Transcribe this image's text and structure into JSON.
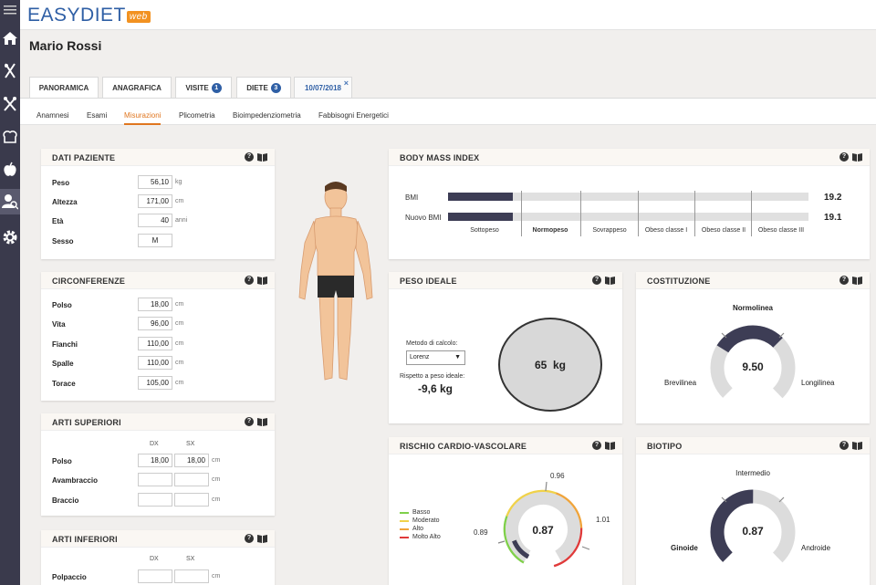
{
  "app": {
    "logo_main": "EASYDIET",
    "logo_web": "web"
  },
  "sidebar": {
    "items": [
      {
        "icon": "menu-icon"
      },
      {
        "icon": "home-icon"
      },
      {
        "icon": "cutlery-icon"
      },
      {
        "icon": "tools-icon"
      },
      {
        "icon": "chef-hat-icon"
      },
      {
        "icon": "apple-icon"
      },
      {
        "icon": "user-search-icon",
        "active": true
      },
      {
        "icon": "gear-icon"
      }
    ]
  },
  "patient": {
    "name": "Mario Rossi"
  },
  "tabs": [
    {
      "label": "PANORAMICA"
    },
    {
      "label": "ANAGRAFICA"
    },
    {
      "label": "VISITE",
      "badge": "1"
    },
    {
      "label": "DIETE",
      "badge": "3"
    },
    {
      "label": "10/07/2018",
      "close": "×"
    }
  ],
  "subnav": [
    "Anamnesi",
    "Esami",
    "Misurazioni",
    "Plicometria",
    "Bioimpedenziometria",
    "Fabbisogni Energetici"
  ],
  "dati_paziente": {
    "title": "DATI PAZIENTE",
    "rows": [
      {
        "label": "Peso",
        "value": "56,10",
        "unit": "kg"
      },
      {
        "label": "Altezza",
        "value": "171,00",
        "unit": "cm"
      },
      {
        "label": "Età",
        "value": "40",
        "unit": "anni"
      },
      {
        "label": "Sesso",
        "value": "M",
        "unit": ""
      }
    ]
  },
  "circonferenze": {
    "title": "CIRCONFERENZE",
    "rows": [
      {
        "label": "Polso",
        "value": "18,00",
        "unit": "cm"
      },
      {
        "label": "Vita",
        "value": "96,00",
        "unit": "cm"
      },
      {
        "label": "Fianchi",
        "value": "110,00",
        "unit": "cm"
      },
      {
        "label": "Spalle",
        "value": "110,00",
        "unit": "cm"
      },
      {
        "label": "Torace",
        "value": "105,00",
        "unit": "cm"
      }
    ]
  },
  "arti_superiori": {
    "title": "ARTI SUPERIORI",
    "col_dx": "DX",
    "col_sx": "SX",
    "rows": [
      {
        "label": "Polso",
        "dx": "18,00",
        "sx": "18,00",
        "unit": "cm"
      },
      {
        "label": "Avambraccio",
        "dx": "",
        "sx": "",
        "unit": "cm"
      },
      {
        "label": "Braccio",
        "dx": "",
        "sx": "",
        "unit": "cm"
      }
    ]
  },
  "arti_inferiori": {
    "title": "ARTI INFERIORI",
    "col_dx": "DX",
    "col_sx": "SX",
    "rows": [
      {
        "label": "Polpaccio",
        "dx": "",
        "sx": "",
        "unit": "cm"
      }
    ]
  },
  "bmi": {
    "title": "BODY MASS INDEX",
    "rows": [
      {
        "label": "BMI",
        "value": "19.2",
        "fill_fraction": 0.18
      },
      {
        "label": "Nuovo BMI",
        "value": "19.1",
        "fill_fraction": 0.18
      }
    ],
    "categories": [
      "Sottopeso",
      "Normopeso",
      "Sovrappeso",
      "Obeso classe I",
      "Obeso classe II",
      "Obeso classe III"
    ],
    "active_category": "Normopeso"
  },
  "peso_ideale": {
    "title": "PESO IDEALE",
    "method_label": "Metodo di calcolo:",
    "method_value": "Lorenz",
    "diff_label": "Rispetto a peso ideale:",
    "diff_value": "-9,6 kg",
    "ideal_value": "65  kg"
  },
  "costituzione": {
    "title": "COSTITUZIONE",
    "value": "9.50",
    "label_top": "Normolinea",
    "label_left": "Brevilinea",
    "label_right": "Longilinea"
  },
  "rischio": {
    "title": "RISCHIO CARDIO-VASCOLARE",
    "value": "0.87",
    "mark_top": "0.96",
    "mark_left": "0.89",
    "mark_right": "1.01",
    "legend": [
      {
        "label": "Basso",
        "color": "#7fd04a"
      },
      {
        "label": "Moderato",
        "color": "#f0d24a"
      },
      {
        "label": "Alto",
        "color": "#f0a43a"
      },
      {
        "label": "Molto Alto",
        "color": "#e03a3a"
      }
    ]
  },
  "biotipo": {
    "title": "BIOTIPO",
    "value": "0.87",
    "label_top": "Intermedio",
    "label_left": "Ginoide",
    "label_right": "Androide"
  }
}
